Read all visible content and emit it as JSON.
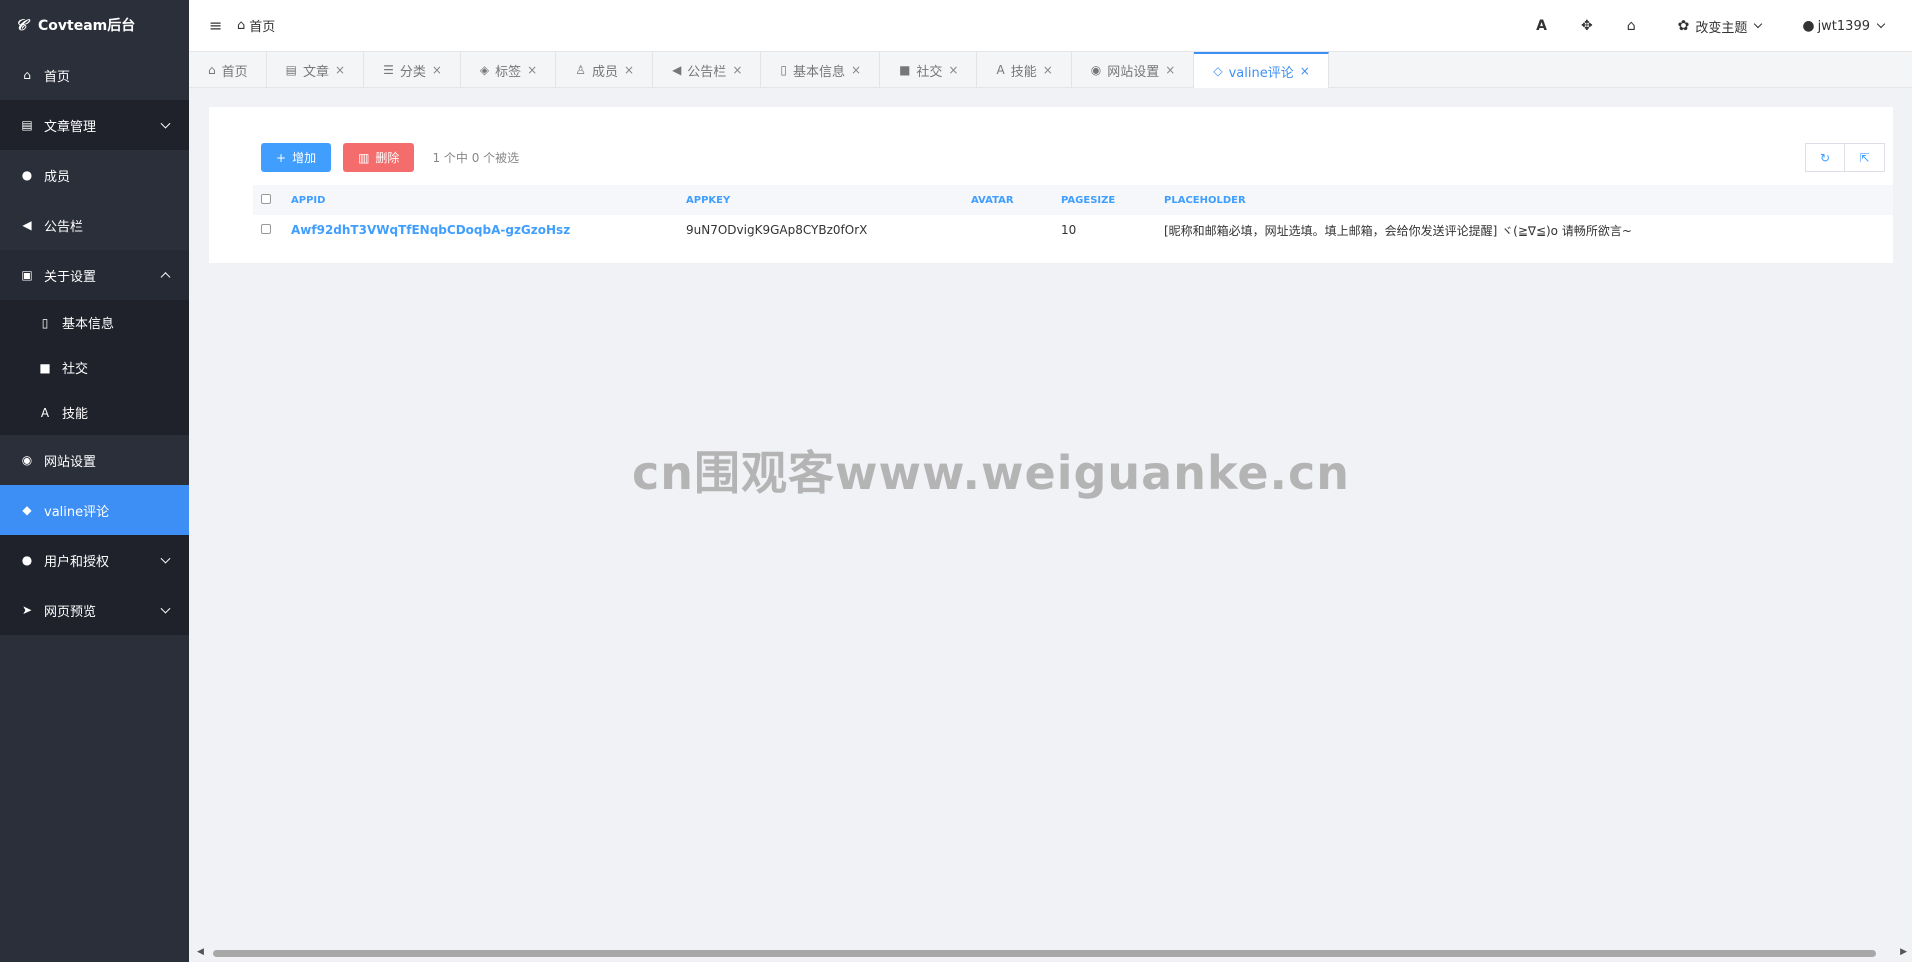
{
  "sidebar": {
    "brand": "Covteam后台",
    "items": [
      {
        "label": "首页",
        "icon": "home-icon",
        "glyph": "⌂"
      },
      {
        "label": "文章管理",
        "icon": "book-icon",
        "glyph": "▤"
      },
      {
        "label": "成员",
        "icon": "user-icon",
        "glyph": "●"
      },
      {
        "label": "公告栏",
        "icon": "bullhorn-icon",
        "glyph": "◀"
      },
      {
        "label": "关于设置",
        "icon": "id-card-icon",
        "glyph": "▣"
      },
      {
        "label": "基本信息",
        "icon": "file-icon",
        "glyph": "▯"
      },
      {
        "label": "社交",
        "icon": "comment-icon",
        "glyph": "■"
      },
      {
        "label": "技能",
        "icon": "skill-icon",
        "glyph": "A"
      },
      {
        "label": "网站设置",
        "icon": "globe-icon",
        "glyph": "◉"
      },
      {
        "label": "valine评论",
        "icon": "comments-icon",
        "glyph": "◆"
      },
      {
        "label": "用户和授权",
        "icon": "user-lock-icon",
        "glyph": "●"
      },
      {
        "label": "网页预览",
        "icon": "paper-plane-icon",
        "glyph": "➤"
      }
    ]
  },
  "header": {
    "breadcrumb": "首页",
    "theme_label": "改变主题",
    "user_label": "jwt1399"
  },
  "tabs": [
    {
      "label": "首页",
      "icon": "home-icon",
      "glyph": "⌂",
      "closable": false
    },
    {
      "label": "文章",
      "icon": "book-icon",
      "glyph": "▤",
      "closable": true
    },
    {
      "label": "分类",
      "icon": "list-icon",
      "glyph": "☰",
      "closable": true
    },
    {
      "label": "标签",
      "icon": "tags-icon",
      "glyph": "◈",
      "closable": true
    },
    {
      "label": "成员",
      "icon": "user-icon",
      "glyph": "♙",
      "closable": true
    },
    {
      "label": "公告栏",
      "icon": "bullhorn-icon",
      "glyph": "◀",
      "closable": true
    },
    {
      "label": "基本信息",
      "icon": "file-icon",
      "glyph": "▯",
      "closable": true
    },
    {
      "label": "社交",
      "icon": "comment-icon",
      "glyph": "■",
      "closable": true
    },
    {
      "label": "技能",
      "icon": "skill-icon",
      "glyph": "A",
      "closable": true
    },
    {
      "label": "网站设置",
      "icon": "globe-icon",
      "glyph": "◉",
      "closable": true
    },
    {
      "label": "valine评论",
      "icon": "comments-icon",
      "glyph": "◇",
      "closable": true,
      "active": true
    }
  ],
  "toolbar": {
    "add_label": "增加",
    "delete_label": "删除",
    "selection_info": "1 个中 0 个被选"
  },
  "table": {
    "columns": [
      "APPID",
      "APPKEY",
      "AVATAR",
      "PAGESIZE",
      "PLACEHOLDER"
    ],
    "rows": [
      {
        "appid": "Awf92dhT3VWqTfENqbCDoqbA-gzGzoHsz",
        "appkey": "9uN7ODvigK9GAp8CYBz0fOrX",
        "avatar": "",
        "pagesize": "10",
        "placeholder": "[昵称和邮箱必填，网址选填。填上邮箱，会给你发送评论提醒] ヾ(≧∇≦)o 请畅所欲言~"
      }
    ]
  },
  "watermark": "cn围观客www.weiguanke.cn",
  "colors": {
    "sidebar_bg": "#2b2f3a",
    "accent": "#3d8ff5",
    "danger": "#f56c6c"
  }
}
